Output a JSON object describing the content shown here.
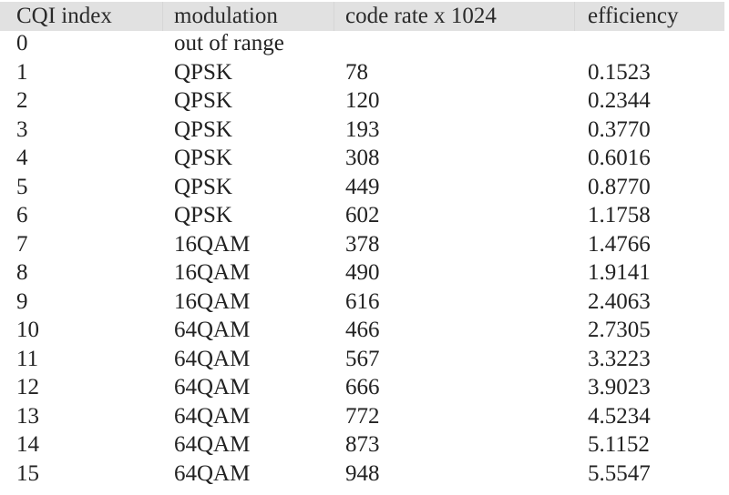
{
  "table": {
    "columns": [
      "CQI index",
      "modulation",
      "code rate x 1024",
      "efficiency"
    ],
    "rows": [
      [
        "0",
        "out of range",
        "",
        ""
      ],
      [
        "1",
        "QPSK",
        "78",
        "0.1523"
      ],
      [
        "2",
        "QPSK",
        "120",
        "0.2344"
      ],
      [
        "3",
        "QPSK",
        "193",
        "0.3770"
      ],
      [
        "4",
        "QPSK",
        "308",
        "0.6016"
      ],
      [
        "5",
        "QPSK",
        "449",
        "0.8770"
      ],
      [
        "6",
        "QPSK",
        "602",
        "1.1758"
      ],
      [
        "7",
        "16QAM",
        "378",
        "1.4766"
      ],
      [
        "8",
        "16QAM",
        "490",
        "1.9141"
      ],
      [
        "9",
        "16QAM",
        "616",
        "2.4063"
      ],
      [
        "10",
        "64QAM",
        "466",
        "2.7305"
      ],
      [
        "11",
        "64QAM",
        "567",
        "3.3223"
      ],
      [
        "12",
        "64QAM",
        "666",
        "3.9023"
      ],
      [
        "13",
        "64QAM",
        "772",
        "4.5234"
      ],
      [
        "14",
        "64QAM",
        "873",
        "5.1152"
      ],
      [
        "15",
        "64QAM",
        "948",
        "5.5547"
      ]
    ]
  },
  "colors": {
    "header_background": "#e1e1e1",
    "text": "#222222",
    "background": "#ffffff"
  }
}
